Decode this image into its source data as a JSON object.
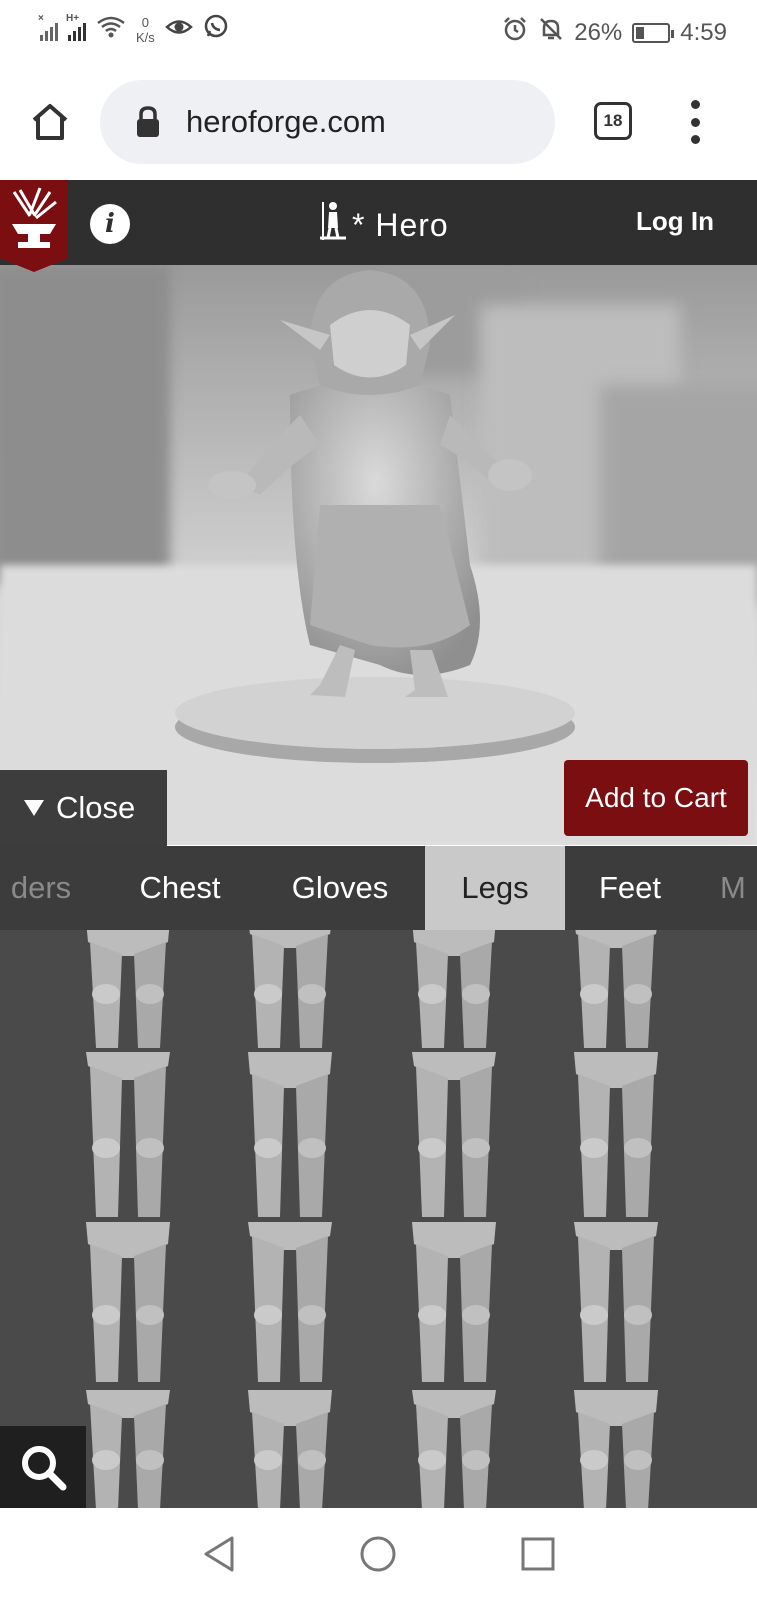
{
  "status_bar": {
    "net_speed_value": "0",
    "net_speed_unit": "K/s",
    "battery_percent": "26%",
    "battery_level": 0.26,
    "time": "4:59"
  },
  "browser": {
    "url": "heroforge.com",
    "tab_count": "18"
  },
  "site": {
    "title": "* Hero",
    "login_label": "Log In"
  },
  "viewer": {
    "close_label": "Close",
    "add_to_cart_label": "Add to Cart"
  },
  "categories": {
    "items": [
      "ders",
      "Chest",
      "Gloves",
      "Legs",
      "Feet",
      "M"
    ],
    "active": "Legs"
  },
  "parts_grid": {
    "rows": 4,
    "columns": 4,
    "icon_names": [
      "leg-armor-icon"
    ]
  }
}
